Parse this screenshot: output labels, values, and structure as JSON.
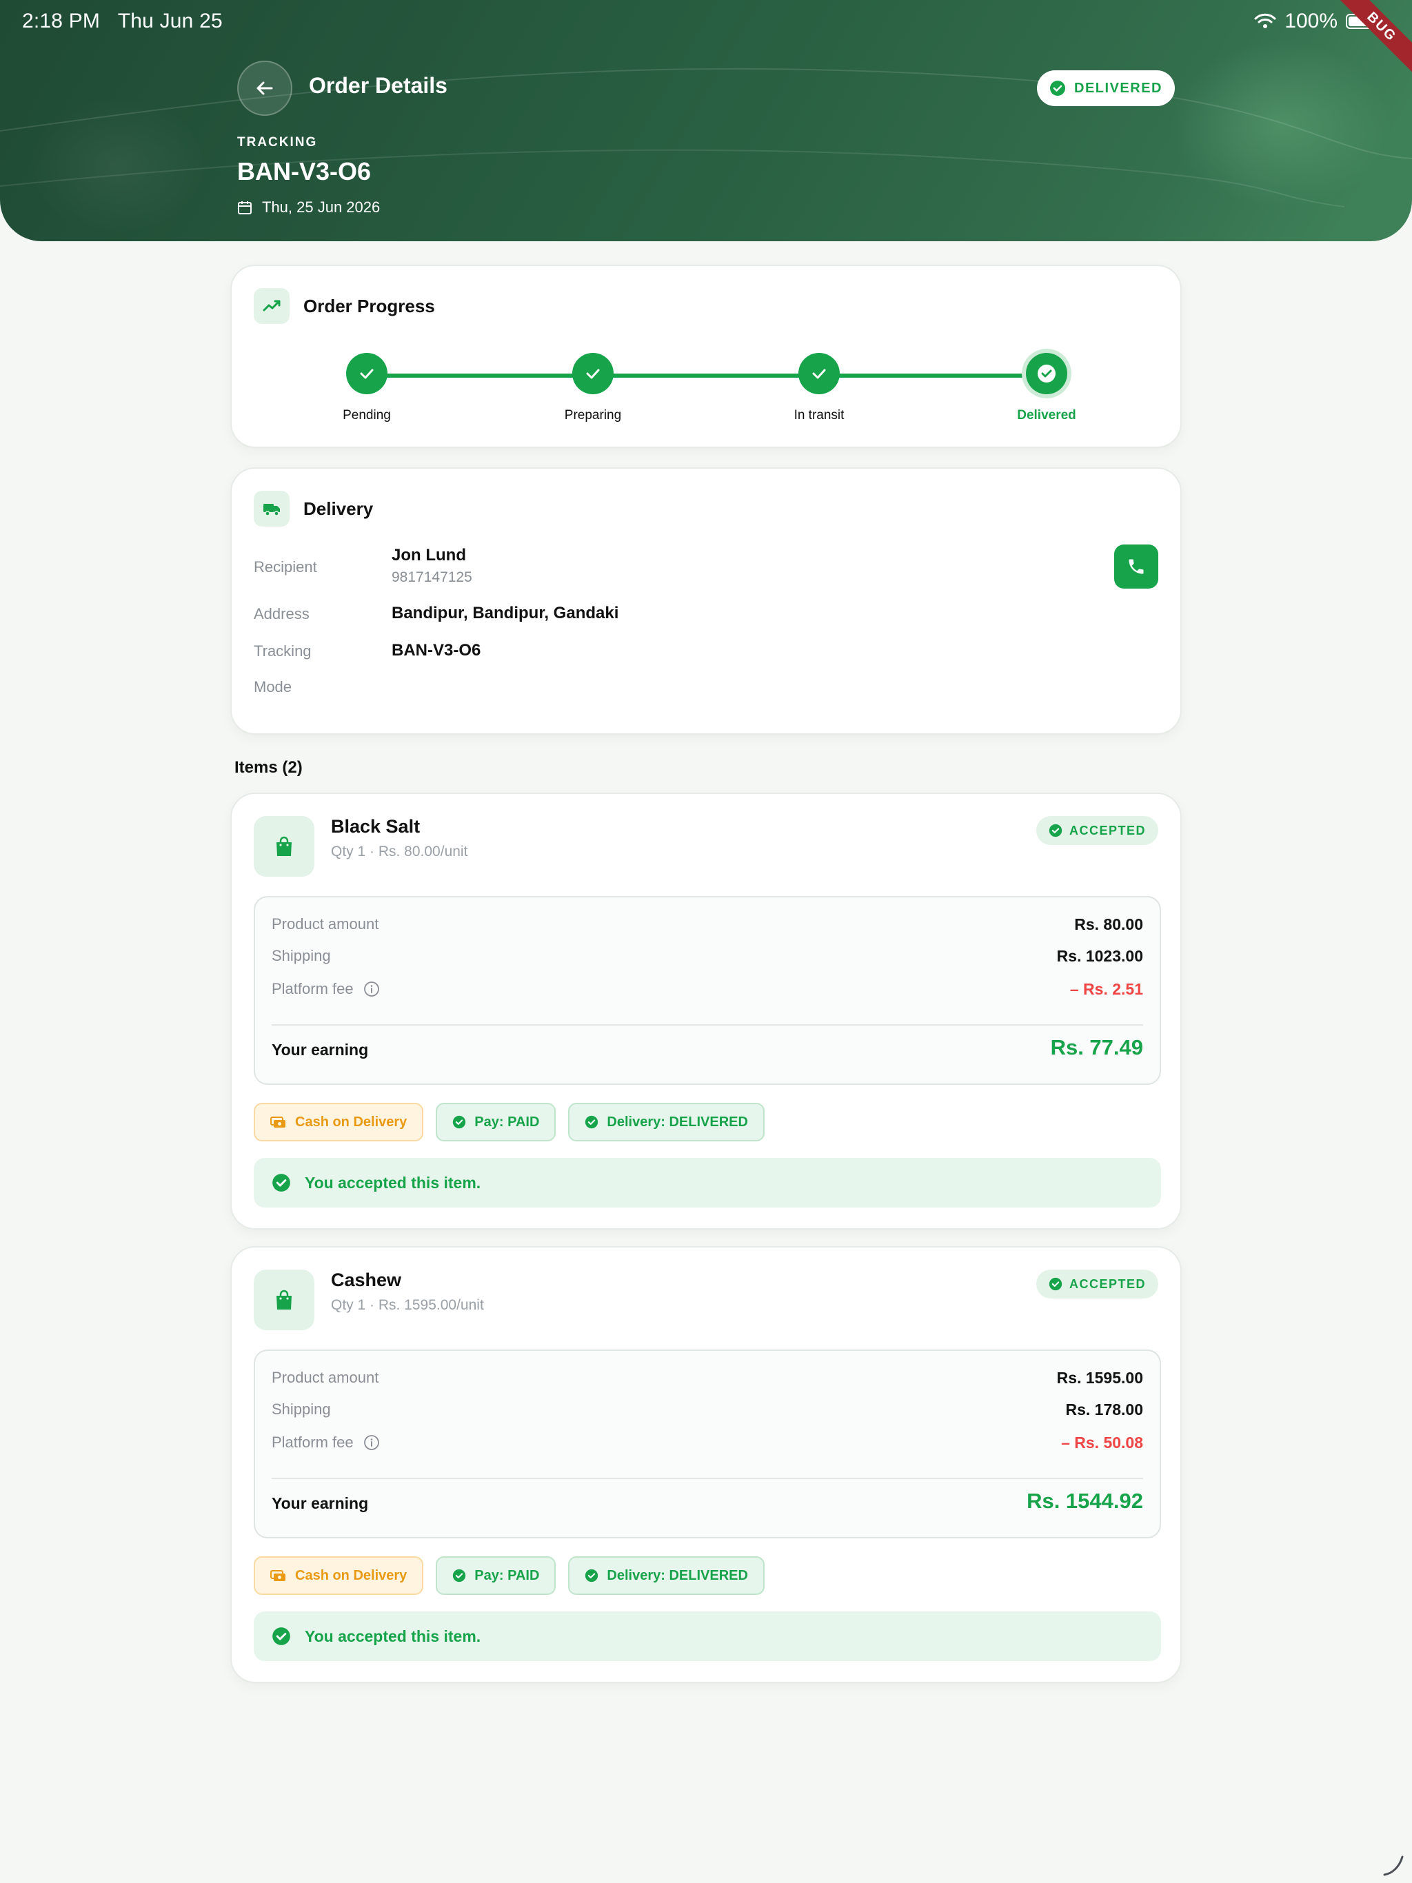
{
  "status_bar": {
    "time": "2:18 PM",
    "date": "Thu Jun 25",
    "battery": "100%"
  },
  "debug_label": "BUG",
  "header": {
    "title": "Order Details",
    "status_badge": "DELIVERED",
    "tracking_label": "TRACKING",
    "tracking_id": "BAN-V3-O6",
    "date": "Thu, 25 Jun 2026"
  },
  "progress": {
    "title": "Order Progress",
    "steps": [
      {
        "label": "Pending"
      },
      {
        "label": "Preparing"
      },
      {
        "label": "In transit"
      },
      {
        "label": "Delivered"
      }
    ],
    "current_step": "Delivered"
  },
  "delivery": {
    "title": "Delivery",
    "recipient_label": "Recipient",
    "recipient_name": "Jon Lund",
    "recipient_phone": "9817147125",
    "address_label": "Address",
    "address": "Bandipur, Bandipur, Gandaki",
    "tracking_label": "Tracking",
    "tracking": "BAN-V3-O6",
    "mode_label": "Mode",
    "mode": ""
  },
  "items_heading": "Items (2)",
  "items": [
    {
      "name": "Black Salt",
      "sub": "Qty 1 · Rs. 80.00/unit",
      "status": "ACCEPTED",
      "product_amount_label": "Product amount",
      "product_amount": "Rs. 80.00",
      "shipping_label": "Shipping",
      "shipping": "Rs. 1023.00",
      "platform_fee_label": "Platform fee",
      "platform_fee": "– Rs. 2.51",
      "earning_label": "Your earning",
      "earning": "Rs. 77.49",
      "chip_payment_method": "Cash on Delivery",
      "chip_pay": "Pay: PAID",
      "chip_delivery": "Delivery: DELIVERED",
      "accepted_message": "You accepted this item."
    },
    {
      "name": "Cashew",
      "sub": "Qty 1 · Rs. 1595.00/unit",
      "status": "ACCEPTED",
      "product_amount_label": "Product amount",
      "product_amount": "Rs. 1595.00",
      "shipping_label": "Shipping",
      "shipping": "Rs. 178.00",
      "platform_fee_label": "Platform fee",
      "platform_fee": "– Rs. 50.08",
      "earning_label": "Your earning",
      "earning": "Rs. 1544.92",
      "chip_payment_method": "Cash on Delivery",
      "chip_pay": "Pay: PAID",
      "chip_delivery": "Delivery: DELIVERED",
      "accepted_message": "You accepted this item."
    }
  ],
  "colors": {
    "accent": "#16a34a",
    "header_dark": "#1f4a34",
    "negative": "#ef4444",
    "cod": "#ea9a12"
  },
  "icons": [
    "back-arrow-icon",
    "check-circle-icon",
    "calendar-icon",
    "trend-icon",
    "truck-icon",
    "phone-icon",
    "shopping-bag-icon",
    "info-icon",
    "cash-icon",
    "wifi-icon",
    "battery-icon"
  ]
}
